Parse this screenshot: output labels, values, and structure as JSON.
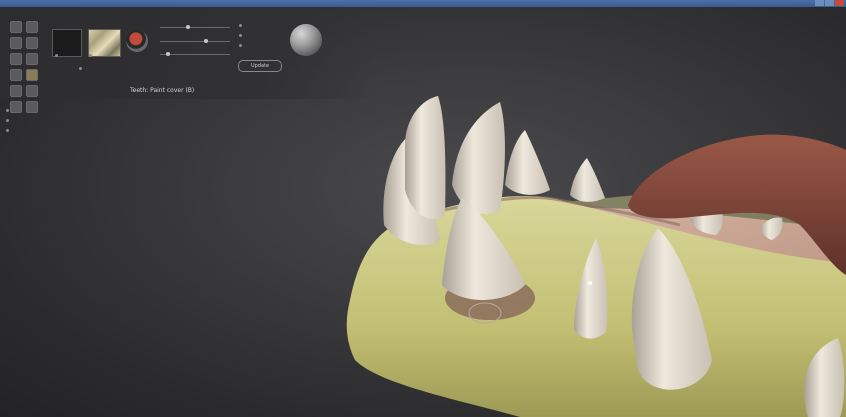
{
  "window": {
    "title": ""
  },
  "panel": {
    "header_left": "",
    "header_material": "",
    "status": "Teeth: Paint cover (B)",
    "update_button": "Update",
    "sidebar": [
      "",
      "",
      ""
    ]
  },
  "colors": {
    "jaw": "#c9c77f",
    "tooth": "#e6dfd3",
    "tongue": "#7b4338",
    "gum": "#8d6a66"
  }
}
